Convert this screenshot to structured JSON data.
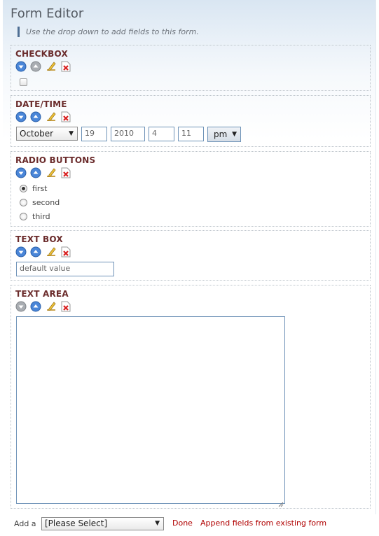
{
  "page": {
    "title": "Form Editor",
    "help": "Use the drop down to add fields to this form."
  },
  "fields": {
    "checkbox": {
      "label": "CHECKBOX"
    },
    "datetime": {
      "label": "DATE/TIME",
      "month": "October",
      "day": "19",
      "year": "2010",
      "hour": "4",
      "minute": "11",
      "ampm": "pm"
    },
    "radio": {
      "label": "RADIO BUTTONS",
      "options": [
        "first",
        "second",
        "third"
      ],
      "selected": "first"
    },
    "textbox": {
      "label": "TEXT BOX",
      "value": "default value"
    },
    "textarea": {
      "label": "TEXT AREA",
      "value": ""
    }
  },
  "icons": [
    "move-down-icon",
    "move-up-icon",
    "edit-icon",
    "delete-icon"
  ],
  "footer": {
    "add_label": "Add a",
    "select_value": "[Please Select]",
    "done": "Done",
    "append": "Append fields from existing form"
  },
  "colors": {
    "field_label": "#6b2c2c",
    "link": "#b00000",
    "input_border": "#6f93b8",
    "help_bar": "#4f6f94"
  }
}
